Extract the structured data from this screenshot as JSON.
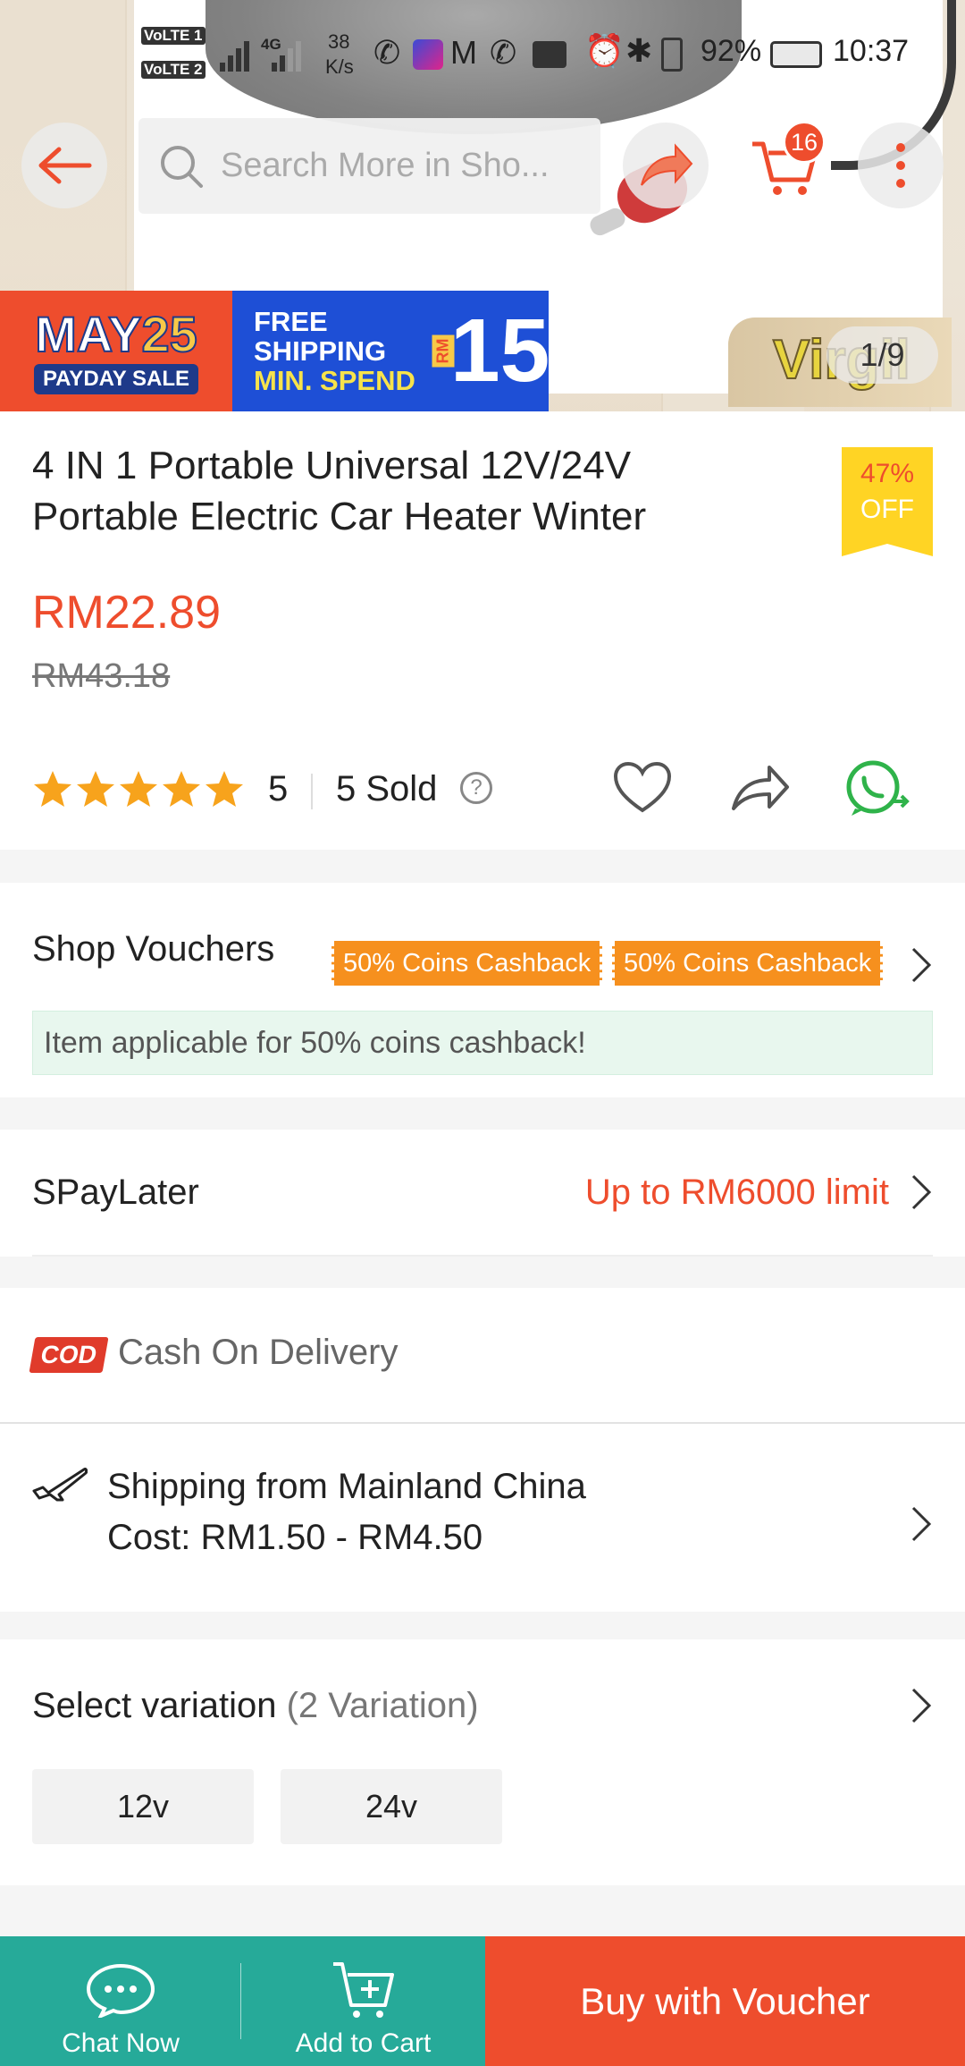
{
  "status_bar": {
    "volte1": "VoLTE 1",
    "volte2": "VoLTE 2",
    "network": "4G",
    "speed_value": "38",
    "speed_unit": "K/s",
    "battery": "92%",
    "time": "10:37"
  },
  "top_nav": {
    "search_placeholder": "Search More in Sho...",
    "cart_count": "16"
  },
  "hero": {
    "promo_may": "MAY",
    "promo_25": "25",
    "promo_payday": "PAYDAY SALE",
    "promo_line1": "FREE",
    "promo_line2": "SHIPPING",
    "promo_line3": "MIN. SPEND",
    "promo_rm": "RM",
    "promo_amount": "15",
    "watermark": "Virgil",
    "image_counter": "1/9"
  },
  "product": {
    "title": "4 IN 1 Portable Universal 12V/24V Portable Electric Car Heater Winter",
    "discount_pct": "47%",
    "discount_label": "OFF",
    "price": "RM22.89",
    "original_price": "RM43.18",
    "rating_value": "5",
    "stars_filled": 5,
    "sold": "5 Sold"
  },
  "vouchers": {
    "label": "Shop Vouchers",
    "tags": [
      "50% Coins Cashback",
      "50% Coins Cashback"
    ],
    "notice": "Item applicable for 50% coins cashback!"
  },
  "paylater": {
    "label": "SPayLater",
    "value": "Up to RM6000 limit"
  },
  "cod": {
    "logo": "COD",
    "label": "Cash On Delivery"
  },
  "shipping": {
    "line1": "Shipping from Mainland China",
    "line2": "Cost: RM1.50 - RM4.50"
  },
  "variation": {
    "label": "Select variation",
    "count": "(2 Variation)",
    "options": [
      "12v",
      "24v"
    ]
  },
  "bottom_bar": {
    "chat": "Chat Now",
    "add_to_cart": "Add to Cart",
    "buy": "Buy with Voucher"
  },
  "colors": {
    "brand": "#ee4d2d",
    "teal": "#26aa99",
    "voucher": "#f6901e",
    "discount_badge": "#ffd424",
    "star": "#f7a31c",
    "whatsapp": "#2fb34a"
  }
}
